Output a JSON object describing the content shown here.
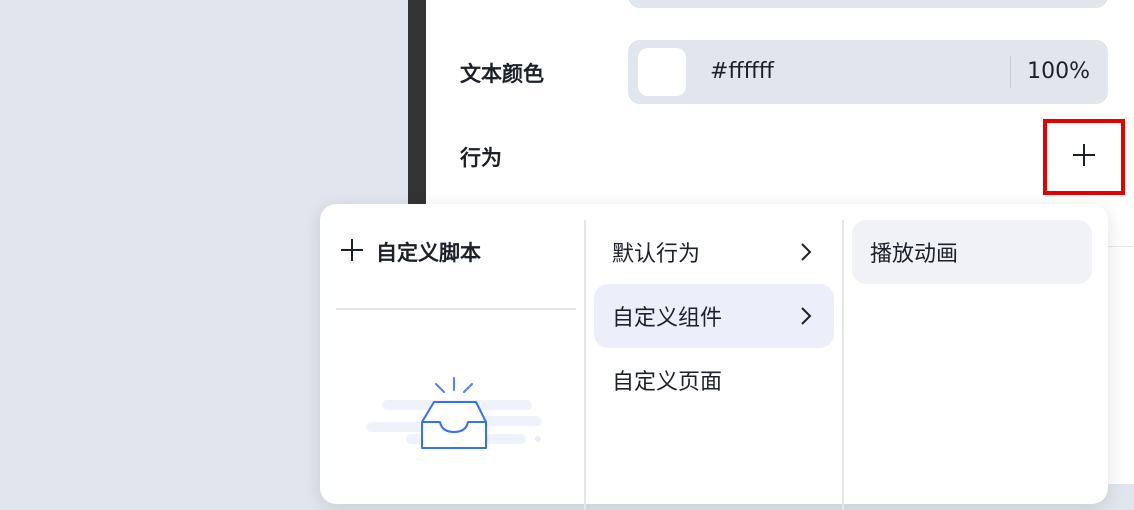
{
  "properties": {
    "text_color": {
      "label": "文本颜色",
      "hex": "#ffffff",
      "opacity": "100%",
      "swatch_color": "#ffffff"
    },
    "behavior": {
      "label": "行为",
      "add_icon": "plus-icon"
    }
  },
  "behavior_menu": {
    "custom_script": {
      "label": "自定义脚本",
      "icon": "plus-icon"
    },
    "empty_state_icon": "empty-inbox-icon",
    "categories": [
      {
        "label": "默认行为",
        "has_submenu": true
      },
      {
        "label": "自定义组件",
        "has_submenu": true,
        "active": true
      },
      {
        "label": "自定义页面",
        "has_submenu": false
      }
    ],
    "actions": [
      {
        "label": "播放动画"
      }
    ]
  },
  "colors": {
    "highlight_border": "#e60000",
    "accent_blue": "#3370ff",
    "active_bg": "#eceffa"
  }
}
